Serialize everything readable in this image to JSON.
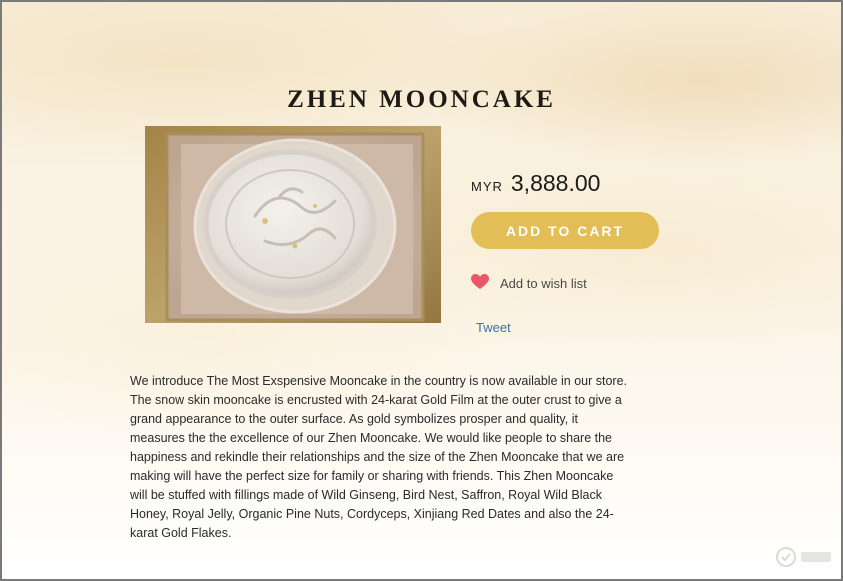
{
  "product": {
    "title": "ZHEN MOONCAKE",
    "image_alt": "Zhen Mooncake in gold-framed gift box"
  },
  "price": {
    "currency": "MYR",
    "amount": "3,888.00"
  },
  "actions": {
    "add_to_cart": "ADD TO CART",
    "wish_list": "Add to wish list",
    "tweet": "Tweet"
  },
  "description": "We introduce The Most Exspensive Mooncake in the country is now available in our store. The snow skin mooncake is encrusted with 24-karat Gold Film at the outer crust to give a grand appearance to the outer surface. As gold symbolizes prosper and quality, it measures the the excellence of our Zhen Mooncake. We would like people to share the happiness and rekindle their relationships and the size of the Zhen Mooncake that we are making will have the perfect size for family or sharing with friends. This Zhen Mooncake will be stuffed with fillings made of Wild Ginseng, Bird Nest, Saffron, Royal Wild Black Honey, Royal Jelly, Organic Pine Nuts, Cordyceps, Xinjiang Red Dates and also the 24-karat Gold Flakes.",
  "colors": {
    "accent": "#e3bd55",
    "heart": "#e8566a",
    "link": "#3d6eb0"
  },
  "icons": {
    "wish": "heart-icon",
    "watermark": "watermark-logo-icon"
  }
}
